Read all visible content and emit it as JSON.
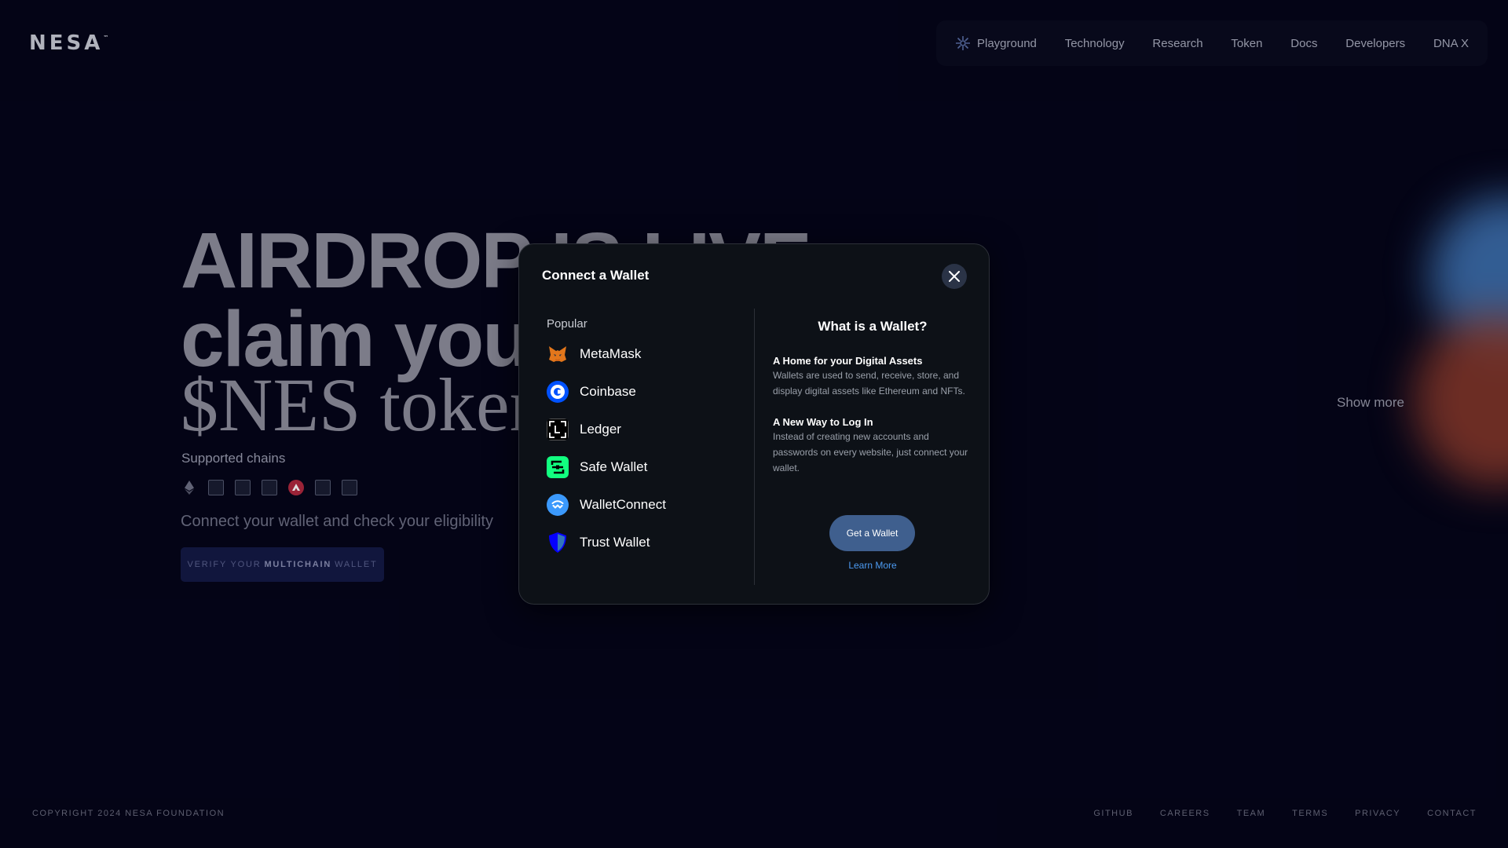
{
  "brand": {
    "logo": "NESA",
    "tm": "™"
  },
  "nav": {
    "items": [
      {
        "label": "Playground",
        "icon": "playground-icon"
      },
      {
        "label": "Technology"
      },
      {
        "label": "Research"
      },
      {
        "label": "Token"
      },
      {
        "label": "Docs"
      },
      {
        "label": "Developers"
      },
      {
        "label": "DNA X"
      }
    ]
  },
  "hero": {
    "line1": "AIRDROP IS LIVE",
    "line2": "claim your",
    "line3": "$NES tokens",
    "supported_chains_label": "Supported chains",
    "connect_text": "Connect your wallet and check your eligibility",
    "verify_prefix": "VERIFY YOUR",
    "verify_bold": "MULTICHAIN",
    "verify_suffix": "WALLET",
    "show_more": "Show more"
  },
  "chains": [
    "ethereum-icon",
    "chain-2-icon",
    "chain-3-icon",
    "chain-4-icon",
    "avalanche-icon",
    "chain-6-icon",
    "chain-7-icon"
  ],
  "footer": {
    "copyright": "COPYRIGHT 2024 NESA FOUNDATION",
    "links": [
      "GITHUB",
      "CAREERS",
      "TEAM",
      "TERMS",
      "PRIVACY",
      "CONTACT"
    ]
  },
  "modal": {
    "title": "Connect a Wallet",
    "section_label": "Popular",
    "wallets": [
      {
        "name": "MetaMask",
        "icon": "metamask-icon",
        "color": "#e2761b"
      },
      {
        "name": "Coinbase",
        "icon": "coinbase-icon",
        "color": "#0052ff"
      },
      {
        "name": "Ledger",
        "icon": "ledger-icon",
        "color": "#000000"
      },
      {
        "name": "Safe Wallet",
        "icon": "safe-wallet-icon",
        "color": "#12ff80"
      },
      {
        "name": "WalletConnect",
        "icon": "walletconnect-icon",
        "color": "#3b99fc"
      },
      {
        "name": "Trust Wallet",
        "icon": "trust-wallet-icon",
        "color": "#0500ff"
      }
    ],
    "info": {
      "title": "What is a Wallet?",
      "block1_title": "A Home for your Digital Assets",
      "block1_text": "Wallets are used to send, receive, store, and display digital assets like Ethereum and NFTs.",
      "block2_title": "A New Way to Log In",
      "block2_text": "Instead of creating new accounts and passwords on every website, just connect your wallet.",
      "get_wallet": "Get a Wallet",
      "learn_more": "Learn More"
    }
  }
}
